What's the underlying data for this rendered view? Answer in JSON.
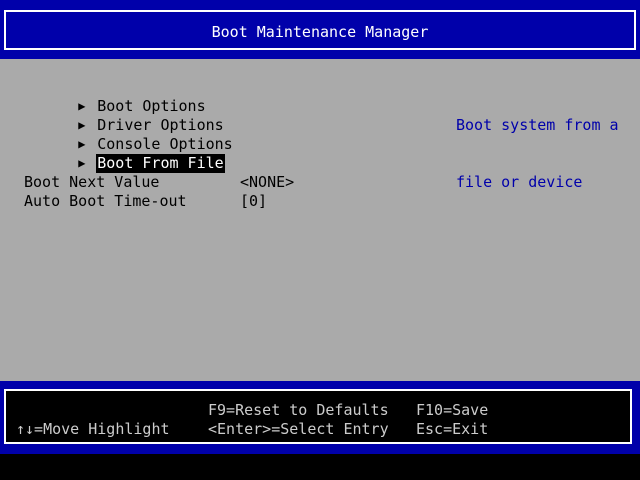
{
  "header": {
    "title": "Boot Maintenance Manager"
  },
  "menu": {
    "items": [
      {
        "label": "Boot Options",
        "selected": false
      },
      {
        "label": "Driver Options",
        "selected": false
      },
      {
        "label": "Console Options",
        "selected": false
      },
      {
        "label": "Boot From File",
        "selected": true
      }
    ],
    "arrow_icon": "triangle-right-icon"
  },
  "settings": [
    {
      "label": "Boot Next Value",
      "value": "<NONE>"
    },
    {
      "label": "Auto Boot Time-out",
      "value": "[0]"
    }
  ],
  "help": {
    "line1": "Boot system from a",
    "line2": "file or device"
  },
  "footer": {
    "move_highlight": "↑↓=Move Highlight",
    "reset_defaults": "F9=Reset to Defaults",
    "select_entry": "<Enter>=Select Entry",
    "save": "F10=Save",
    "exit": "Esc=Exit"
  },
  "colors": {
    "band_blue": "#0000aa",
    "body_grey": "#aaaaaa",
    "help_text_blue": "#0000aa",
    "highlight_bg": "#000000",
    "highlight_fg": "#ffffff"
  }
}
